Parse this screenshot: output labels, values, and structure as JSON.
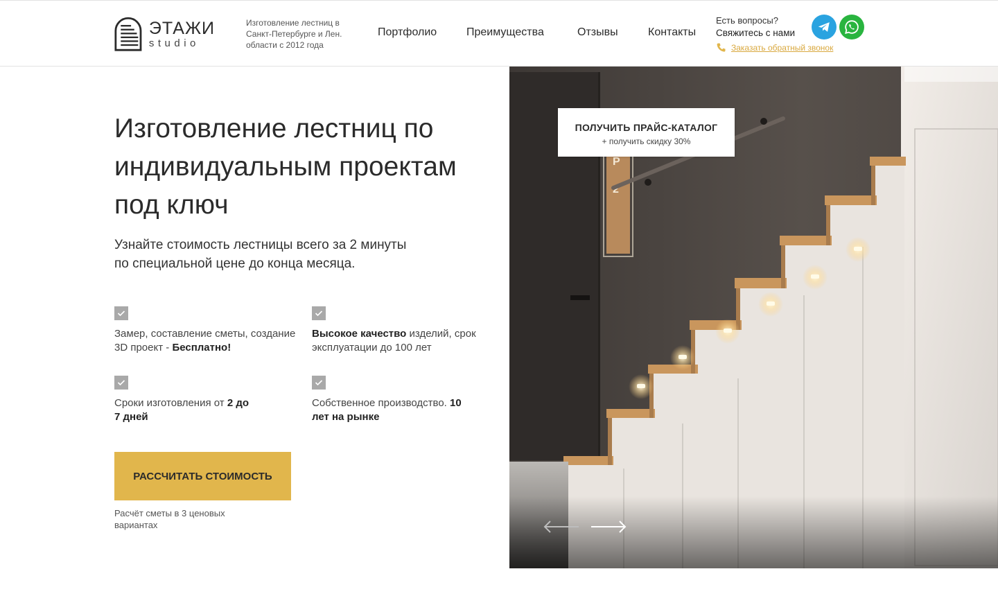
{
  "header": {
    "logo_title": "ЭТАЖИ",
    "logo_sub": "studio",
    "tagline": "Изготовление лестниц в Санкт-Петербурге и Лен. области с 2012 года",
    "nav": [
      {
        "label": "Портфолио"
      },
      {
        "label": "Преимущества"
      },
      {
        "label": "Отзывы"
      },
      {
        "label": "Контакты"
      }
    ],
    "contact_question": "Есть вопросы?",
    "contact_cta": "Свяжитесь с нами",
    "callback_link": "Заказать обратный звонок",
    "social": [
      {
        "icon": "telegram-icon",
        "color": "#2aa3e0"
      },
      {
        "icon": "whatsapp-icon",
        "color": "#29b43f"
      }
    ]
  },
  "hero": {
    "title": "Изготовление лестниц по индивидуальным проектам под ключ",
    "subtitle_line1": "Узнайте стоимость лестницы всего за 2 минуты",
    "subtitle_line2": "по специальной цене до конца месяца."
  },
  "features": [
    {
      "pre": "Замер, составление сметы, создание 3D проект - ",
      "bold": "Бесплатно!",
      "post": ""
    },
    {
      "pre": "",
      "bold": "Высокое качество",
      "post": " изделий, срок эксплуатации до 100 лет"
    },
    {
      "pre": "Сроки изготовления от ",
      "bold": "2 до 7 дней",
      "post": ""
    },
    {
      "pre": "Собственное производство. ",
      "bold": "10 лет на рынке",
      "post": ""
    }
  ],
  "cta": {
    "button_label": "РАССЧИТАТЬ СТОИМОСТЬ",
    "note": "Расчёт сметы в 3 ценовых вариантах"
  },
  "promo": {
    "title": "ПОЛУЧИТЬ ПРАЙС-КАТАЛОГ",
    "subtitle": "+ получить скидку 30%"
  },
  "colors": {
    "accent": "#e1b64c",
    "link": "#d9a83e",
    "check": "#a9a9a9"
  }
}
